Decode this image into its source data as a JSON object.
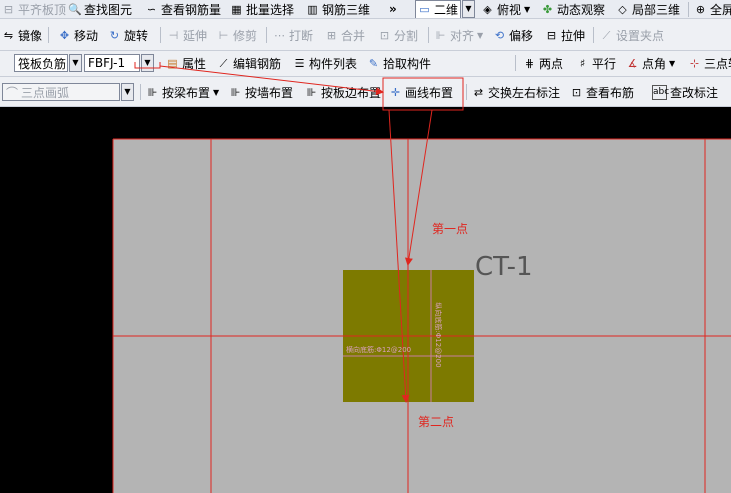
{
  "toolbar1": {
    "items": [
      "平齐板顶",
      "查找图元",
      "查看钢筋量",
      "批量选择",
      "钢筋三维",
      "二维",
      "俯视",
      "动态观察",
      "局部三维",
      "全屏"
    ]
  },
  "toolbar2": {
    "items": [
      "镜像",
      "移动",
      "旋转",
      "延伸",
      "修剪",
      "打断",
      "合并",
      "分割",
      "对齐",
      "偏移",
      "拉伸",
      "设置夹点"
    ]
  },
  "toolbar3": {
    "category_combo": "筏板负筋",
    "name_combo": "FBFJ-1",
    "items": [
      "属性",
      "编辑钢筋",
      "构件列表",
      "拾取构件",
      "两点",
      "平行",
      "点角",
      "三点轴"
    ]
  },
  "toolbar4": {
    "arc_combo": "三点画弧",
    "items": [
      "按梁布置",
      "按墙布置",
      "按板边布置",
      "画线布置",
      "交换左右标注",
      "查看布筋",
      "查改标注"
    ]
  },
  "drawing": {
    "component_name": "CT-1",
    "rebar_text_h": "横向底筋:Φ12@200",
    "rebar_text_v": "纵向底筋:Φ12@200",
    "first_point": "第一点",
    "second_point": "第二点",
    "colors": {
      "canvas": "#b4b4b4",
      "cap": "#7d7a00",
      "axis": "#e0261f",
      "highlight": "#e0261f"
    }
  }
}
